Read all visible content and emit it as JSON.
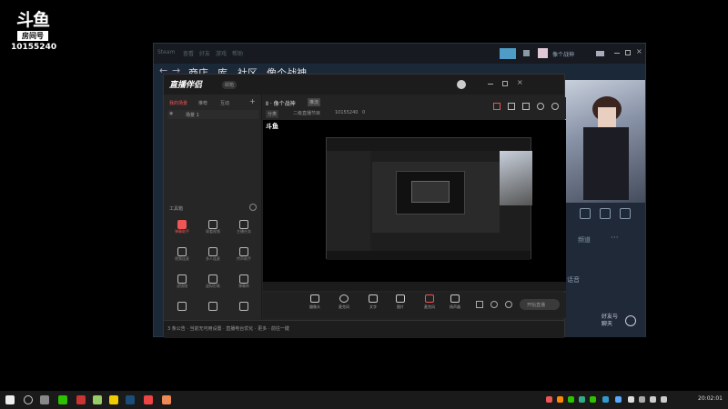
{
  "watermark": {
    "brand": "斗鱼",
    "label": "房间号",
    "room": "10155240"
  },
  "steam": {
    "menu": [
      "Steam",
      "查看",
      "好友",
      "游戏",
      "帮助"
    ],
    "nav": [
      "商店",
      "库",
      "社区",
      "像个战神"
    ],
    "user": "像个战神",
    "side_text": [
      "频道",
      "话音",
      "好友与\n聊天"
    ],
    "side_label": "好友"
  },
  "obs": {
    "app_title": "直播伴侣",
    "badge": "邮箱",
    "tabs": [
      "我的场景",
      "推荐",
      "互动"
    ],
    "scene": "场景 1",
    "tools_title": "工具箱",
    "tools": [
      {
        "label": "弹幕助手"
      },
      {
        "label": "观看视频"
      },
      {
        "label": "主播任务"
      },
      {
        "label": "视频连麦"
      },
      {
        "label": "多人连麦"
      },
      {
        "label": "传声助手"
      },
      {
        "label": "滤镜镜"
      },
      {
        "label": "虚拟形象"
      },
      {
        "label": "弹幕库"
      }
    ],
    "stream_title": "Ⅱ · 像个战神",
    "stream_tag": "推流",
    "sub_info": "二级直播节目",
    "room": "10155240",
    "viewers": "0",
    "bottom_buttons": [
      "摄像头",
      "麦克风",
      "文字",
      "图片",
      "麦克风",
      "扬声器"
    ],
    "start_btn": "开始直播",
    "status_text": "3 条公告 · 当前无可用设置 · 直播电台优化 · 更多 · 前往一键"
  },
  "taskbar": {
    "time": "20:02:01"
  }
}
